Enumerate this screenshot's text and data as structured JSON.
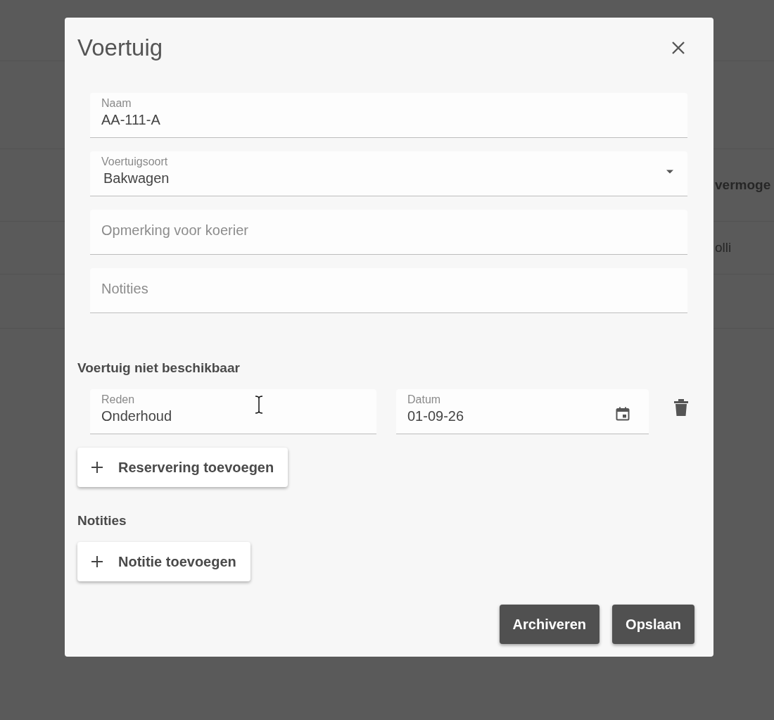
{
  "background": {
    "column_header": "vermoge",
    "cell": "olli"
  },
  "dialog": {
    "title": "Voertuig",
    "fields": [
      {
        "kind": "text",
        "label": "Naam",
        "value": "AA-111-A"
      },
      {
        "kind": "select",
        "label": "Voertuigsoort",
        "value": "Bakwagen"
      },
      {
        "kind": "text",
        "placeholder": "Opmerking voor koerier"
      },
      {
        "kind": "text",
        "placeholder": "Notities"
      }
    ],
    "unavailable": {
      "heading": "Voertuig niet beschikbaar",
      "reason": {
        "label": "Reden",
        "value": "Onderhoud"
      },
      "date": {
        "label": "Datum",
        "value": "01-09-26"
      },
      "add_button": "Reservering toevoegen"
    },
    "notes": {
      "heading": "Notities",
      "add_button": "Notitie toevoegen"
    },
    "actions": [
      "Archiveren",
      "Opslaan"
    ]
  }
}
